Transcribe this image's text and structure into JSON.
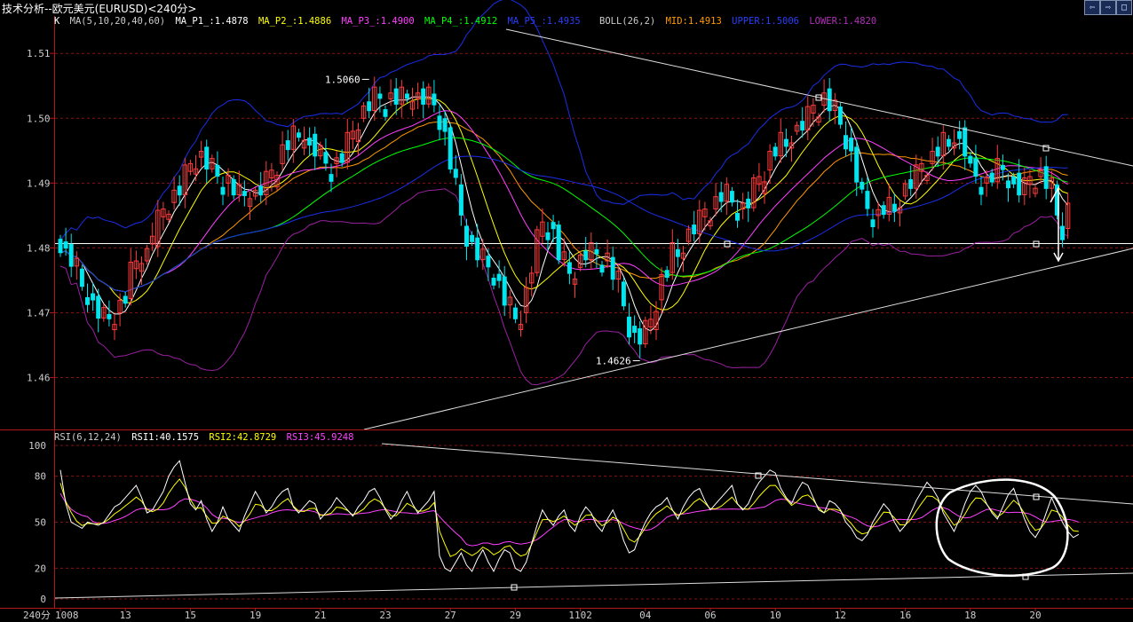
{
  "window": {
    "title": "技术分析--欧元美元(EURUSD)<240分>",
    "buttons": [
      {
        "name": "scroll-left-button",
        "glyph": "⇦"
      },
      {
        "name": "scroll-right-button",
        "glyph": "⇨"
      },
      {
        "name": "maximize-button",
        "glyph": "□"
      }
    ]
  },
  "legend_main": {
    "k": "K",
    "ma": "MA(5,10,20,40,60)",
    "ma_p1": "MA_P1_:1.4878",
    "ma_p2": "MA_P2_:1.4886",
    "ma_p3": "MA_P3_:1.4900",
    "ma_p4": "MA_P4_:1.4912",
    "ma_p5": "MA_P5_:1.4935",
    "boll": "BOLL(26,2)",
    "mid": "MID:1.4913",
    "upper": "UPPER:1.5006",
    "lower": "LOWER:1.4820"
  },
  "legend_rsi": {
    "rsi": "RSI(6,12,24)",
    "rsi1": "RSI1:40.1575",
    "rsi2": "RSI2:42.8729",
    "rsi3": "RSI3:45.9248"
  },
  "colors": {
    "up": "#ff3b3b",
    "down": "#00e5ee",
    "ma1": "#ffffff",
    "ma2": "#ffff00",
    "ma3": "#ff40ff",
    "ma4": "#00ff00",
    "ma5": "#1a2ee8",
    "boll_mid": "#ff9900",
    "boll_upper": "#1a2ee8",
    "boll_lower": "#9a20a0",
    "rsi1": "#ffffff",
    "rsi2": "#ffff00",
    "rsi3": "#ff40ff",
    "grid": "#8a1010",
    "axis": "#b01818"
  },
  "chart_data": [
    {
      "type": "candlestick",
      "symbol": "EURUSD",
      "interval": "240分",
      "ylim": [
        1.452,
        1.5155
      ],
      "yticks": [
        1.46,
        1.47,
        1.48,
        1.49,
        1.5,
        1.51
      ],
      "ytick_labels": [
        "1.46",
        "1.47",
        "1.48",
        "1.49",
        "1.50",
        "1.51"
      ],
      "x_dates": [
        "1008",
        "13",
        "15",
        "19",
        "21",
        "23",
        "27",
        "29",
        "1102",
        "04",
        "06",
        "10",
        "12",
        "16",
        "18",
        "20"
      ],
      "x_date_index": [
        0,
        12,
        24,
        36,
        48,
        60,
        72,
        84,
        96,
        108,
        120,
        132,
        144,
        156,
        168,
        180
      ],
      "x_axis_label": "240分",
      "close": [
        1.481,
        1.479,
        1.478,
        1.476,
        1.474,
        1.473,
        1.471,
        1.47,
        1.469,
        1.469,
        1.47,
        1.471,
        1.473,
        1.476,
        1.478,
        1.478,
        1.479,
        1.481,
        1.484,
        1.486,
        1.487,
        1.488,
        1.489,
        1.491,
        1.493,
        1.494,
        1.494,
        1.493,
        1.492,
        1.491,
        1.49,
        1.489,
        1.489,
        1.488,
        1.488,
        1.488,
        1.488,
        1.489,
        1.49,
        1.491,
        1.493,
        1.495,
        1.496,
        1.497,
        1.497,
        1.497,
        1.496,
        1.495,
        1.494,
        1.493,
        1.493,
        1.493,
        1.494,
        1.496,
        1.498,
        1.5,
        1.501,
        1.502,
        1.503,
        1.503,
        1.503,
        1.503,
        1.503,
        1.503,
        1.503,
        1.503,
        1.503,
        1.503,
        1.503,
        1.502,
        1.5,
        1.497,
        1.493,
        1.489,
        1.485,
        1.482,
        1.48,
        1.479,
        1.478,
        1.477,
        1.476,
        1.474,
        1.472,
        1.47,
        1.469,
        1.47,
        1.473,
        1.477,
        1.481,
        1.484,
        1.484,
        1.482,
        1.479,
        1.477,
        1.476,
        1.477,
        1.478,
        1.479,
        1.479,
        1.479,
        1.478,
        1.477,
        1.476,
        1.474,
        1.471,
        1.468,
        1.466,
        1.466,
        1.467,
        1.469,
        1.472,
        1.475,
        1.477,
        1.479,
        1.48,
        1.481,
        1.482,
        1.483,
        1.484,
        1.485,
        1.486,
        1.487,
        1.488,
        1.488,
        1.487,
        1.486,
        1.486,
        1.487,
        1.489,
        1.49,
        1.492,
        1.494,
        1.495,
        1.496,
        1.497,
        1.498,
        1.498,
        1.499,
        1.5,
        1.501,
        1.502,
        1.503,
        1.502,
        1.501,
        1.499,
        1.497,
        1.494,
        1.491,
        1.488,
        1.486,
        1.485,
        1.485,
        1.486,
        1.486,
        1.487,
        1.488,
        1.489,
        1.49,
        1.491,
        1.492,
        1.493,
        1.494,
        1.495,
        1.496,
        1.497,
        1.498,
        1.497,
        1.495,
        1.493,
        1.491,
        1.49,
        1.49,
        1.491,
        1.492,
        1.492,
        1.491,
        1.49,
        1.489,
        1.489,
        1.49,
        1.491,
        1.491,
        1.49,
        1.489,
        1.485,
        1.483,
        1.486
      ],
      "annotations": [
        {
          "text": "1.5060",
          "index": 57,
          "price": 1.506
        },
        {
          "text": "1.4626",
          "index": 107,
          "price": 1.4626
        }
      ]
    },
    {
      "type": "line",
      "name": "RSI",
      "ylim": [
        0,
        100
      ],
      "yticks": [
        0,
        20,
        50,
        80,
        100
      ],
      "ytick_labels": [
        "0",
        "20",
        "50",
        "80",
        "100"
      ],
      "rsi_shape": [
        84,
        62,
        50,
        48,
        46,
        50,
        49,
        48,
        50,
        55,
        60,
        62,
        66,
        70,
        74,
        66,
        56,
        58,
        64,
        70,
        80,
        86,
        90,
        76,
        62,
        58,
        64,
        52,
        44,
        50,
        60,
        52,
        48,
        44,
        54,
        62,
        70,
        64,
        56,
        60,
        66,
        70,
        72,
        60,
        56,
        60,
        64,
        62,
        52,
        56,
        60,
        66,
        62,
        58,
        54,
        60,
        64,
        70,
        72,
        66,
        58,
        52,
        56,
        64,
        70,
        62,
        56,
        60,
        64,
        70,
        28,
        20,
        18,
        24,
        30,
        22,
        18,
        26,
        32,
        24,
        18,
        26,
        32,
        30,
        20,
        18,
        24,
        36,
        48,
        58,
        52,
        48,
        54,
        58,
        48,
        44,
        54,
        60,
        56,
        48,
        44,
        52,
        58,
        50,
        38,
        30,
        32,
        42,
        50,
        56,
        60,
        62,
        66,
        58,
        52,
        60,
        66,
        70,
        72,
        64,
        58,
        62,
        66,
        70,
        74,
        62,
        58,
        62,
        70,
        76,
        80,
        84,
        82,
        72,
        66,
        62,
        70,
        76,
        74,
        66,
        58,
        56,
        64,
        62,
        58,
        50,
        46,
        40,
        38,
        42,
        50,
        56,
        62,
        58,
        50,
        44,
        48,
        56,
        64,
        70,
        76,
        72,
        66,
        56,
        50,
        44,
        52,
        62,
        70,
        74,
        70,
        62,
        56,
        52,
        60,
        68,
        72,
        62,
        52,
        44,
        40,
        46,
        56,
        66,
        58,
        50,
        44,
        40,
        42
      ]
    }
  ]
}
